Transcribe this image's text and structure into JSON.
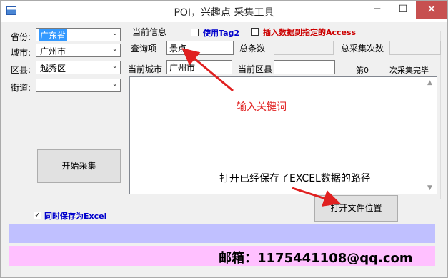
{
  "window": {
    "title": "POI，兴趣点 采集工具",
    "minimize": "─",
    "maximize": "☐",
    "close": "✕"
  },
  "left": {
    "province_label": "省份:",
    "province_value": "广东省",
    "city_label": "城市:",
    "city_value": "广州市",
    "district_label": "区县:",
    "district_value": "越秀区",
    "street_label": "街道:",
    "street_value": "",
    "start_button": "开始采集",
    "save_excel_label": "同时保存为Excel",
    "save_excel_checked": true
  },
  "info": {
    "group_label": "当前信息",
    "use_tag2_label": "使用Tag2",
    "insert_access_label": "插入数据到指定的Access",
    "query_label": "查询项",
    "query_value": "景点",
    "total_label": "总条数",
    "total_value": "",
    "total_count_label": "总采集次数",
    "total_count_value": "",
    "current_city_label": "当前城市",
    "current_city_value": "广州市",
    "current_district_label": "当前区县",
    "current_district_value": "",
    "progress_nth": "第0",
    "progress_done": "次采集完毕",
    "open_folder_button": "打开文件位置"
  },
  "annotations": {
    "keyword": "输入关键词",
    "excel_path": "打开已经保存了EXCEL数据的路径",
    "color": "#e02020"
  },
  "footer": {
    "email": "邮箱：1175441108@qq.com"
  },
  "colors": {
    "bar1": "#c0c0ff",
    "bar2": "#ffc0ff",
    "accent_blue": "#0000cc",
    "accent_red": "#cc0000",
    "selection": "#3399ff"
  }
}
